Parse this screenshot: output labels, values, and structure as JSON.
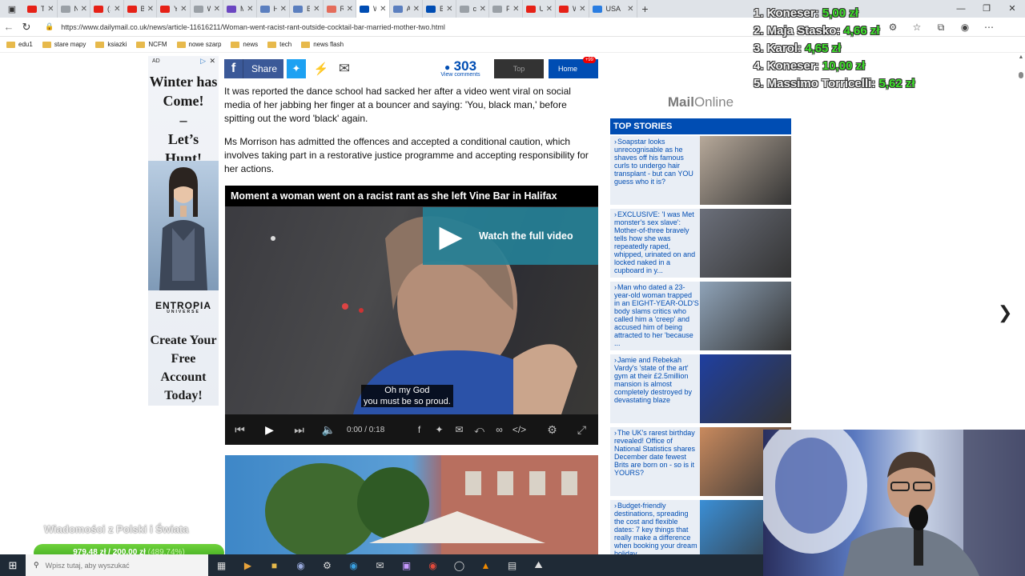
{
  "browser": {
    "tabs": [
      {
        "title": "Trans",
        "color": "#e62117",
        "active": false
      },
      {
        "title": "Now",
        "color": "#9aa0a6",
        "active": false
      },
      {
        "title": "(1) K",
        "color": "#e62117",
        "active": false
      },
      {
        "title": "Broth",
        "color": "#e62117",
        "active": false
      },
      {
        "title": "YouT",
        "color": "#e62117",
        "active": false
      },
      {
        "title": "Wyp",
        "color": "#9aa0a6",
        "active": false
      },
      {
        "title": "Maja",
        "color": "#6b46c1",
        "active": false
      },
      {
        "title": "Ham",
        "color": "#5b7fbf",
        "active": false
      },
      {
        "title": "Boy",
        "color": "#5b7fbf",
        "active": false
      },
      {
        "title": "Red",
        "color": "#e46c5b",
        "active": false
      },
      {
        "title": "Won",
        "color": "#004db3",
        "active": true
      },
      {
        "title": "Afgh",
        "color": "#5b7fbf",
        "active": false
      },
      {
        "title": "Briti",
        "color": "#004db3",
        "active": false
      },
      {
        "title": "com",
        "color": "#9aa0a6",
        "active": false
      },
      {
        "title": "Polk",
        "color": "#9aa0a6",
        "active": false
      },
      {
        "title": "ULTI",
        "color": "#e62117",
        "active": false
      },
      {
        "title": "Wh",
        "color": "#e62117",
        "active": false
      },
      {
        "title": "USA",
        "color": "#2a7de1",
        "active": false
      }
    ],
    "url": "https://www.dailymail.co.uk/news/article-11616211/Woman-went-racist-rant-outside-cocktail-bar-married-mother-two.html",
    "bookmarks": [
      "edu1",
      "stare mapy",
      "ksiazki",
      "NCFM",
      "nowe szarp",
      "news",
      "tech",
      "news flash"
    ]
  },
  "ad": {
    "label": "AD",
    "headline": [
      "Winter has",
      "Come!",
      "–",
      "Let’s Hunt!"
    ],
    "brand": "ENTROPIA",
    "brand_sub": "UNIVERSE",
    "cta": [
      "Create Your",
      "Free Account",
      "Today!"
    ]
  },
  "share": {
    "facebook_label": "Share",
    "comment_count": "303",
    "comments_label": "View comments",
    "top_label": "Top",
    "home_label": "Home",
    "home_badge": "+99"
  },
  "article": {
    "para1": "It was reported the dance school had sacked her after a video went viral on social media of her jabbing her finger at a bouncer and saying: 'You, black man,' before spitting out the word 'black' again.",
    "para2": "Ms Morrison has admitted the offences and accepted a conditional caution, which involves taking part in a restorative justice programme and accepting responsibility for her actions."
  },
  "video": {
    "title": "Moment a woman went on a racist rant as she left Vine Bar in Halifax",
    "watch_label": "Watch the full video",
    "subtitle_line1": "Oh my God",
    "subtitle_line2": "you must be so proud.",
    "time": "0:00 / 0:18"
  },
  "sidebar": {
    "logo_bold": "Mail",
    "logo_rest": "Online",
    "heading": "TOP STORIES",
    "stories": [
      {
        "text": "Soapstar looks unrecognisable as he shaves off his famous curls to undergo hair transplant - but can YOU guess who it is?",
        "thumb": "#b7a99a"
      },
      {
        "text": "EXCLUSIVE: 'I was Met monster's sex slave': Mother-of-three bravely tells how she was repeatedly raped, whipped, urinated on and locked naked in a cupboard in y...",
        "thumb": "#6b6f7a"
      },
      {
        "text": "Man who dated a 23-year-old woman trapped in an EIGHT-YEAR-OLD'S body slams critics who called him a 'creep' and accused him of being attracted to her 'because ...",
        "thumb": "#8fa3b8"
      },
      {
        "text": "Jamie and Rebekah Vardy's 'state of the art' gym at their £2.5million mansion is almost completely destroyed by devastating blaze",
        "thumb": "#1f3fa0"
      },
      {
        "text": "The UK's rarest birthday revealed! Office of National Statistics shares December date fewest Brits are born on - so is it YOURS?",
        "thumb": "#c98a5e"
      },
      {
        "text": "Budget-friendly destinations, spreading the cost and flexible dates: 7 key things that really make a difference when booking your dream holiday",
        "thumb": "#3b8fd6"
      }
    ]
  },
  "overlay": {
    "ranking": [
      {
        "name": "1. Koneser: ",
        "amount": "5,00 zł"
      },
      {
        "name": "2. Maja Stasko: ",
        "amount": "4,66 zł"
      },
      {
        "name": "3. Karol: ",
        "amount": "4,65 zł"
      },
      {
        "name": "4. Koneser: ",
        "amount": "10,00 zł"
      },
      {
        "name": "5. Massimo Torricelli: ",
        "amount": "5,62 zł"
      }
    ],
    "news_label": "Wiadomości z Polski i Świata",
    "goal_raised": "979,48 zł",
    "goal_target": "200,00 zł",
    "goal_percent": "(489.74%)",
    "goal_fill": 1.0
  },
  "taskbar": {
    "search_placeholder": "Wpisz tutaj, aby wyszukać"
  }
}
